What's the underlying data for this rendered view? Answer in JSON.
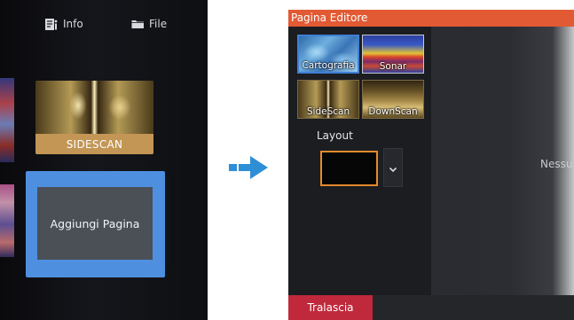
{
  "home": {
    "topbar": {
      "info_label": "Info",
      "file_label": "File",
      "info_icon": "info-document-icon",
      "file_icon": "folder-icon"
    },
    "sidescan_tile_label": "SIDESCAN",
    "add_page_label": "Aggiungi Pagina"
  },
  "arrow": {
    "icon": "arrow-right-icon",
    "color": "#2f8fd6"
  },
  "editor": {
    "title": "Pagina Editore",
    "header_color": "#e25a33",
    "apps": [
      {
        "label": "Cartografia",
        "selected": true
      },
      {
        "label": "Sonar",
        "selected": false
      },
      {
        "label": "SideScan",
        "selected": false
      },
      {
        "label": "DownScan",
        "selected": false
      }
    ],
    "layout_label": "Layout",
    "layout_dropdown_icon": "chevron-down-icon",
    "empty_message": "Nessu",
    "skip_label": "Tralascia",
    "skip_color": "#c0283c",
    "selection_color": "#e58a2c"
  }
}
